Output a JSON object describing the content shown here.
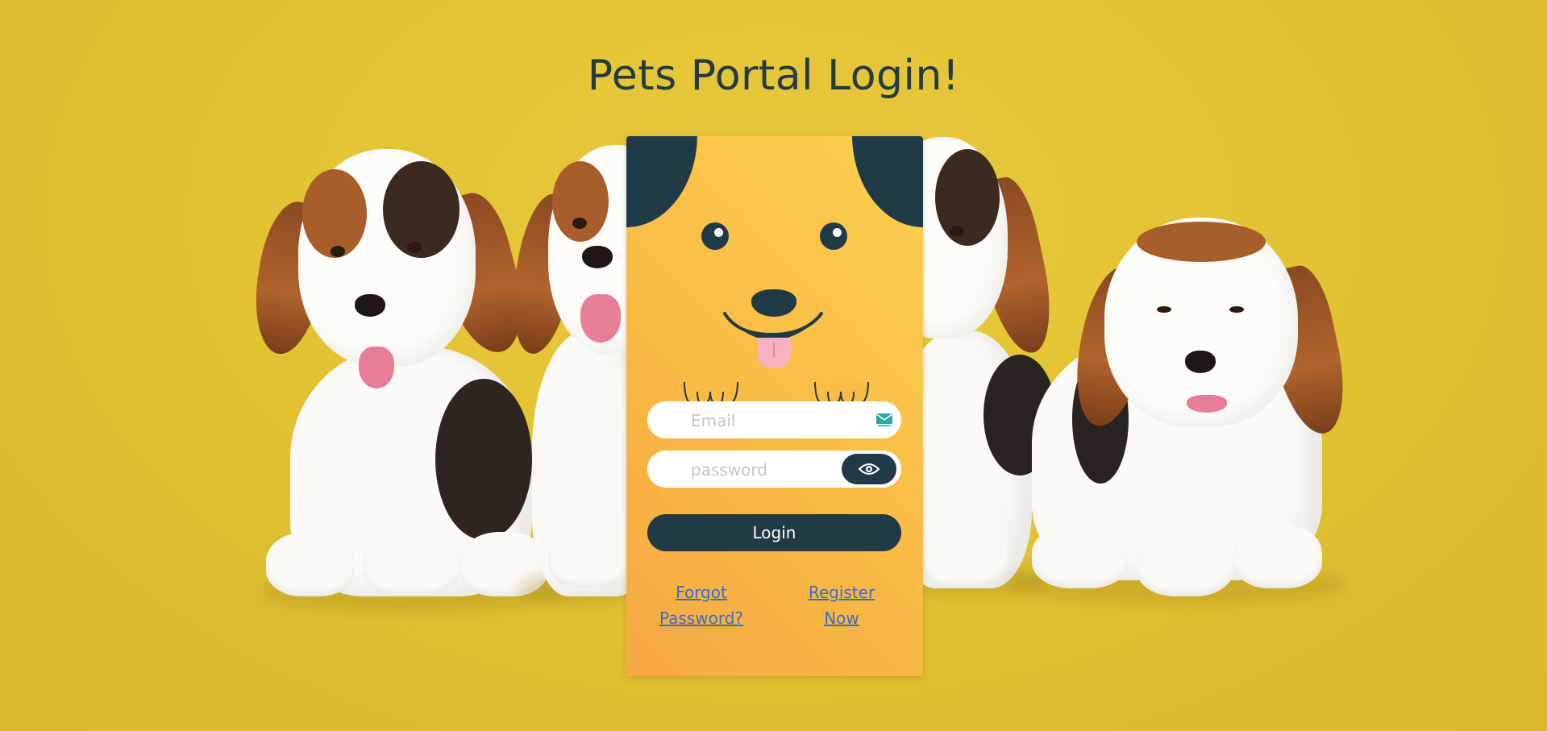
{
  "page": {
    "title": "Pets Portal Login!"
  },
  "login_form": {
    "email_placeholder": "Email",
    "password_placeholder": "password",
    "login_label": "Login",
    "forgot_password_line1": "Forgot",
    "forgot_password_line2": "Password?",
    "register_line1": "Register",
    "register_line2": "Now"
  },
  "icons": {
    "email": "mail-icon",
    "password_toggle": "eye-icon"
  },
  "colors": {
    "background": "#e2c333",
    "card_gradient_top": "#fbd04f",
    "card_gradient_bottom": "#f7a843",
    "accent_dark": "#213a47",
    "title": "#243a45",
    "link": "#3a6cc6",
    "tongue": "#f4a9b8"
  }
}
